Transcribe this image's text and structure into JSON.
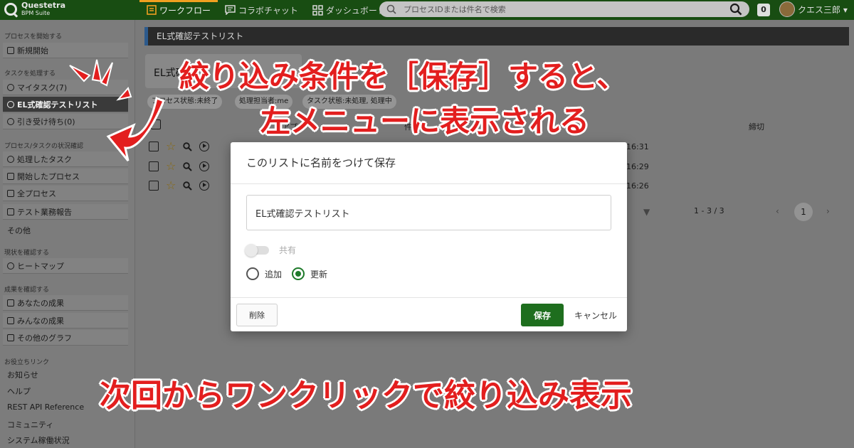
{
  "header": {
    "logo_title": "Questetra",
    "logo_subtitle": "BPM Suite",
    "nav": [
      {
        "label": "ワークフロー",
        "icon": "workflow-icon"
      },
      {
        "label": "コラボチャット",
        "icon": "chat-icon"
      },
      {
        "label": "ダッシュボード",
        "icon": "dashboard-icon"
      }
    ],
    "search_placeholder": "プロセスIDまたは件名で検索",
    "badge_count": "0",
    "user_name": "クエス三郎 ▾"
  },
  "sidebar": {
    "sec_start": "プロセスを開始する",
    "new_start": "新規開始",
    "sec_tasks": "タスクを処理する",
    "my_task": "マイタスク(7)",
    "el_list": "EL式確認テストリスト",
    "offered": "引き受け待ち(0)",
    "sec_status": "プロセス/タスクの状況確認",
    "processed": "処理したタスク",
    "started": "開始したプロセス",
    "all_process": "全プロセス",
    "test_report": "テスト業務報告",
    "other": "その他",
    "sec_current": "現状を確認する",
    "heatmap": "ヒートマップ",
    "sec_results": "成果を確認する",
    "your_results": "あなたの成果",
    "everyone_results": "みんなの成果",
    "other_graphs": "その他のグラフ",
    "sec_links": "お役立ちリンク",
    "news": "お知らせ",
    "help": "ヘルプ",
    "rest_api": "REST API Reference",
    "community": "コミュニティ",
    "system_status": "システム稼働状況"
  },
  "main": {
    "list_title": "EL式確認テストリスト",
    "filter_value": "EL式確認",
    "chips": [
      "プロセス状態:未終了",
      "処理担当者:me",
      "タスク状態:未処理, 処理中"
    ],
    "col_app": "アプリ",
    "col_subject": "件名",
    "col_deadline": "締切",
    "times": [
      "16:31",
      "16:29",
      "16:26"
    ],
    "pager": "1 - 3 / 3",
    "page": "1"
  },
  "dialog": {
    "title": "このリストに名前をつけて保存",
    "name_value": "EL式確認テストリスト",
    "share_label": "共有",
    "add_label": "追加",
    "update_label": "更新",
    "delete_label": "削除",
    "save_label": "保存",
    "cancel_label": "キャンセル"
  },
  "captions": {
    "line1": "絞り込み条件を［保存］すると、",
    "line2": "左メニューに表示される",
    "line3": "次回からワンクリックで絞り込み表示"
  },
  "colors": {
    "header_bg": "#184d12",
    "save_button": "#1e6e1e",
    "caption_red": "#e31e1e",
    "accent_orange": "#f0a020"
  }
}
